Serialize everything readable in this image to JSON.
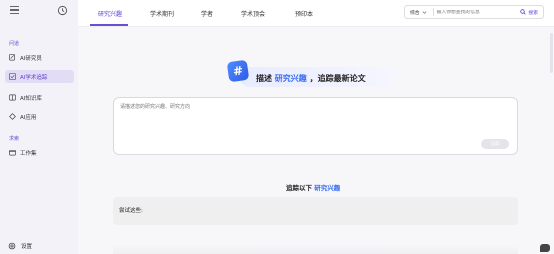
{
  "sidebar": {
    "sections": [
      {
        "title": "问道",
        "items": [
          {
            "label": "AI研究员"
          },
          {
            "label": "AI学术追踪"
          },
          {
            "label": "AI知识库"
          },
          {
            "label": "AI应用"
          }
        ]
      },
      {
        "title": "求索",
        "items": [
          {
            "label": "工作集"
          }
        ]
      }
    ],
    "settings_label": "设置"
  },
  "topbar": {
    "tabs": [
      {
        "label": "研究兴趣",
        "active": true
      },
      {
        "label": "学术期刊",
        "active": false
      },
      {
        "label": "学者",
        "active": false
      },
      {
        "label": "学术顶会",
        "active": false
      },
      {
        "label": "预印本",
        "active": false
      }
    ],
    "search": {
      "category": "综合",
      "placeholder": "输入你想查找的信息",
      "button_label": "搜索"
    }
  },
  "main": {
    "banner": {
      "hash": "#",
      "text_before": "描述",
      "highlight": "研究兴趣",
      "text_after": "，追踪最新论文"
    },
    "input": {
      "placeholder": "请描述您的研究兴趣、研究方向",
      "submit_label": "追踪"
    },
    "follow": {
      "prefix": "追踪以下",
      "highlight": "研究兴趣"
    },
    "try_label": "尝试这些:"
  },
  "colors": {
    "accent": "#6a4fd1",
    "highlight_blue": "#3b6ef0",
    "sidebar_bg": "#f3f2f8",
    "active_item_bg": "#e2ddf5"
  }
}
